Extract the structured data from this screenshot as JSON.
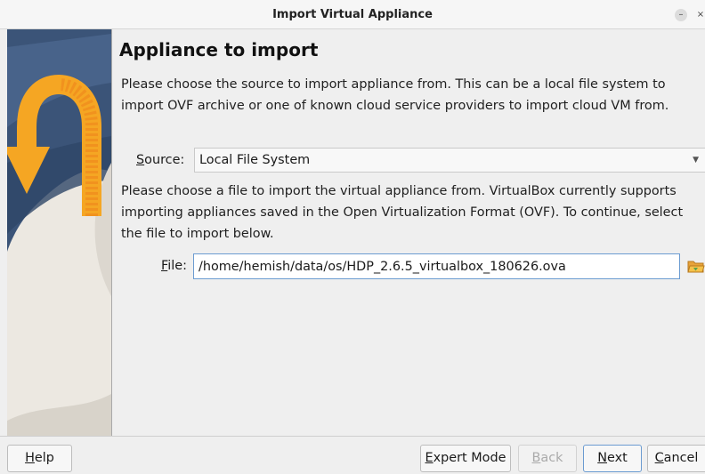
{
  "window": {
    "title": "Import Virtual Appliance",
    "minimize_glyph": "–",
    "close_glyph": "×"
  },
  "page": {
    "heading": "Appliance to import",
    "intro_text": "Please choose the source to import appliance from. This can be a local file system to import OVF archive or one of known cloud service providers to import cloud VM from.",
    "file_instructions": "Please choose a file to import the virtual appliance from. VirtualBox currently supports importing appliances saved in the Open Virtualization Format (OVF). To continue, select the file to import below."
  },
  "source": {
    "label_mnemonic": "S",
    "label_rest": "ource:",
    "selected": "Local File System"
  },
  "file": {
    "label_mnemonic": "F",
    "label_rest": "ile:",
    "value": "/home/hemish/data/os/HDP_2.6.5_virtualbox_180626.ova",
    "browse_icon": "folder-open-icon"
  },
  "buttons": {
    "help": {
      "mnemonic": "H",
      "rest": "elp"
    },
    "expert": {
      "mnemonic": "E",
      "rest": "xpert Mode"
    },
    "back": {
      "mnemonic": "B",
      "rest": "ack",
      "enabled": false
    },
    "next": {
      "mnemonic": "N",
      "rest": "ext"
    },
    "cancel": {
      "mnemonic": "C",
      "rest": "ancel"
    }
  },
  "colors": {
    "accent": "#6b9bd1",
    "banner_arrow": "#f5a623",
    "banner_sky": "#3d5a80"
  }
}
